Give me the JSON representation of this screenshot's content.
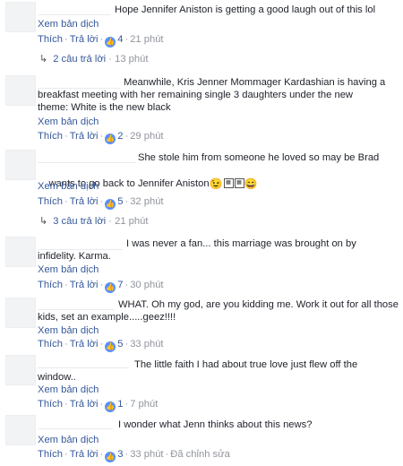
{
  "ui": {
    "translate": "Xem bản dịch",
    "like": "Thích",
    "reply": "Trả lời",
    "sep": "·"
  },
  "comments": [
    {
      "text": "Hope Jennifer Aniston is getting a good laugh out of this lol",
      "likes": "4",
      "time": "21 phút",
      "replies": "2 câu trả lời",
      "replies_time": "13 phút"
    },
    {
      "text_line1": "Meanwhile, Kris Jenner Mommager Kardashian is having a",
      "text_line2": "breakfast meeting with her remaining single 3 daughters under the new",
      "text_line3": "theme: White is the new black",
      "likes": "2",
      "time": "29 phút"
    },
    {
      "text_line1": "She stole him from someone he loved so may be Brad",
      "text_line2": "wants to go back to Jennifer Aniston",
      "likes": "5",
      "time": "32 phút",
      "replies": "3 câu trả lời",
      "replies_time": "21 phút"
    },
    {
      "text_line1": "I was never a fan... this marriage was brought on by",
      "text_line2": "infidelity. Karma.",
      "likes": "7",
      "time": "30 phút"
    },
    {
      "text_line1": "WHAT. Oh my god, are you kidding me. Work it out for all those",
      "text_line2": "kids, set an example.....geez!!!!",
      "likes": "5",
      "time": "33 phút"
    },
    {
      "text_line1": "The little faith I had about true love just flew off the",
      "text_line2": "window..",
      "likes": "1",
      "time": "7 phút"
    },
    {
      "text": "I wonder what Jenn thinks about this news?",
      "likes": "3",
      "time": "33 phút",
      "edited": "Đã chỉnh sửa"
    }
  ],
  "icons": {
    "like": "like-icon",
    "reply_arrow": "reply-arrow-icon",
    "emoji": "emoji-icon"
  },
  "colors": {
    "link": "#365899",
    "meta": "#90949c",
    "like_badge": "#5890ff"
  }
}
